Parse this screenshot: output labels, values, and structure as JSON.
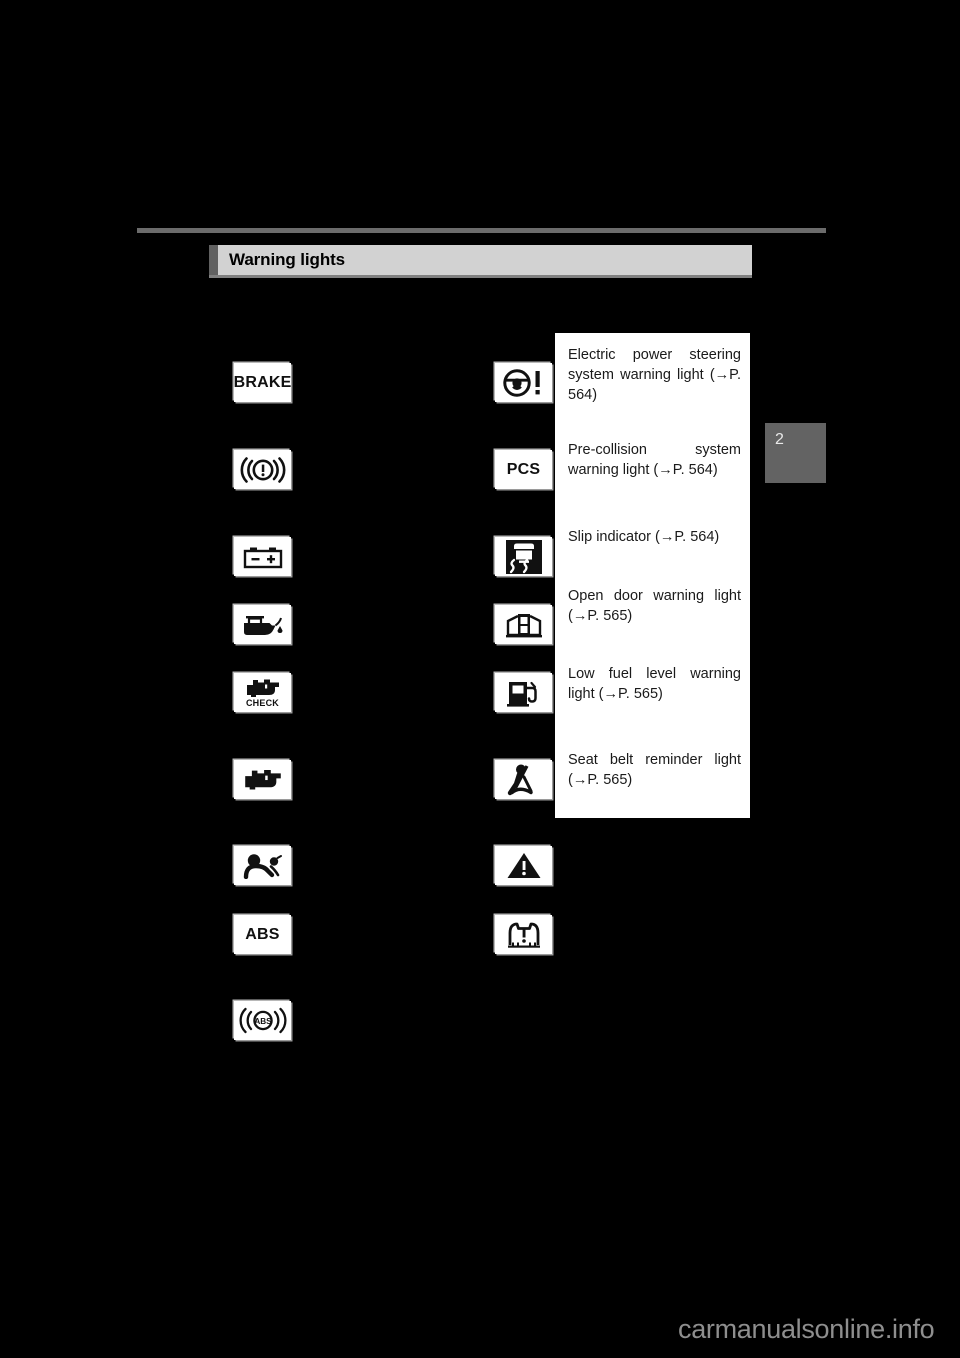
{
  "page": {
    "background_color": "#000000",
    "chapter_number": "2",
    "watermark": "carmanualsonline.info"
  },
  "header": {
    "title": "Warning lights",
    "bar_color": "#d2d2d2",
    "stripe_color": "#616161",
    "rule_color": "#6b6b6b"
  },
  "left_column": {
    "icons": [
      {
        "name": "brake-warning-light-icon",
        "label": "BRAKE",
        "glyph": "BRAKE"
      },
      {
        "name": "brake-system-warning-light-icon",
        "label": "Brake system warning light",
        "glyph": "((!))"
      },
      {
        "name": "charging-system-warning-light-icon",
        "label": "Charging system warning light",
        "glyph": "battery"
      },
      {
        "name": "low-engine-oil-pressure-warning-light-icon",
        "label": "Low engine oil pressure warning light",
        "glyph": "oil-can"
      },
      {
        "name": "check-engine-warning-light-icon",
        "label": "CHECK engine warning light",
        "glyph": "engine-CHECK"
      },
      {
        "name": "malfunction-indicator-lamp-icon",
        "label": "Malfunction indicator lamp",
        "glyph": "engine"
      },
      {
        "name": "srs-airbag-warning-light-icon",
        "label": "SRS warning light",
        "glyph": "airbag"
      },
      {
        "name": "abs-warning-light-icon",
        "label": "ABS",
        "glyph": "ABS"
      },
      {
        "name": "brake-hold-abs-indicator-icon",
        "label": "ABS indicator",
        "glyph": "((ABS))"
      }
    ]
  },
  "right_column": {
    "rows": [
      {
        "icon_name": "electric-power-steering-warning-light-icon",
        "icon_glyph": "steering-wheel-exclamation",
        "text": "Electric power steering system warning light (→P. 564)"
      },
      {
        "icon_name": "pre-collision-system-warning-light-icon",
        "icon_glyph": "PCS",
        "text": "Pre-collision system warning light (→P. 564)"
      },
      {
        "icon_name": "slip-indicator-icon",
        "icon_glyph": "car-skid",
        "text": "Slip indicator (→P. 564)"
      },
      {
        "icon_name": "open-door-warning-light-icon",
        "icon_glyph": "car-open-doors",
        "text": "Open door warning light (→P. 565)"
      },
      {
        "icon_name": "low-fuel-level-warning-light-icon",
        "icon_glyph": "fuel-pump",
        "text": "Low fuel level warning light (→P. 565)"
      },
      {
        "icon_name": "seat-belt-reminder-light-icon",
        "icon_glyph": "seated-person-belt",
        "text": "Seat belt reminder light (→P. 565)"
      }
    ],
    "extra_icons": [
      {
        "name": "master-warning-light-icon",
        "glyph": "triangle-exclamation"
      },
      {
        "name": "tire-pressure-warning-light-icon",
        "glyph": "tire-exclamation"
      }
    ]
  }
}
